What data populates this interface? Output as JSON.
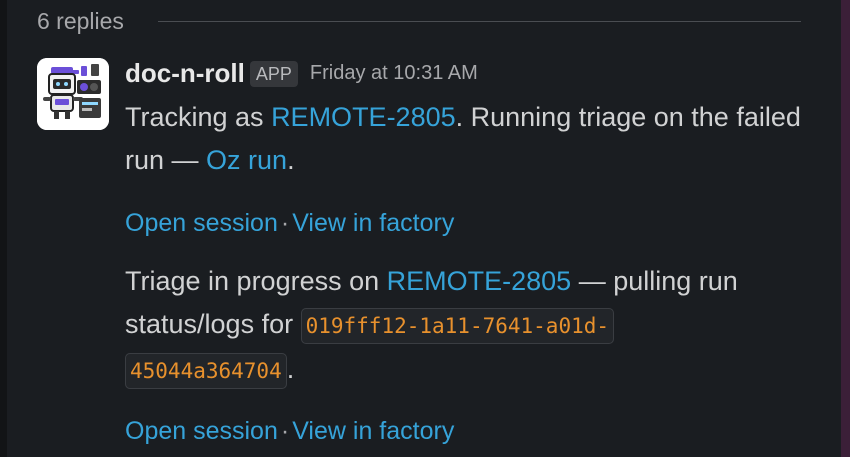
{
  "thread": {
    "replies_label": "6 replies"
  },
  "message": {
    "author": "doc-n-roll",
    "badge": "APP",
    "timestamp": "Friday at 10:31 AM",
    "avatar_icon": "robot-dj-avatar",
    "posts": [
      {
        "text_before": "Tracking as ",
        "ticket_link": "REMOTE-2805",
        "text_middle": ". Running triage on the failed run — ",
        "run_link": "Oz run",
        "text_after": ".",
        "action_open": "Open session",
        "action_separator": "·",
        "action_view": "View in factory"
      },
      {
        "text_before": "Triage in progress on ",
        "ticket_link": "REMOTE-2805",
        "text_middle": " — pulling run status/logs for ",
        "code_part1": "019fff12-1a11-7641-a01d-",
        "code_part2": "45044a364704",
        "text_after": ".",
        "action_open": "Open session",
        "action_separator": "·",
        "action_view": "View in factory"
      }
    ]
  },
  "colors": {
    "background": "#1a1d21",
    "link": "#36a3d9",
    "code": "#e8912d",
    "text": "#d1d2d3",
    "muted": "#a7a8ab"
  }
}
